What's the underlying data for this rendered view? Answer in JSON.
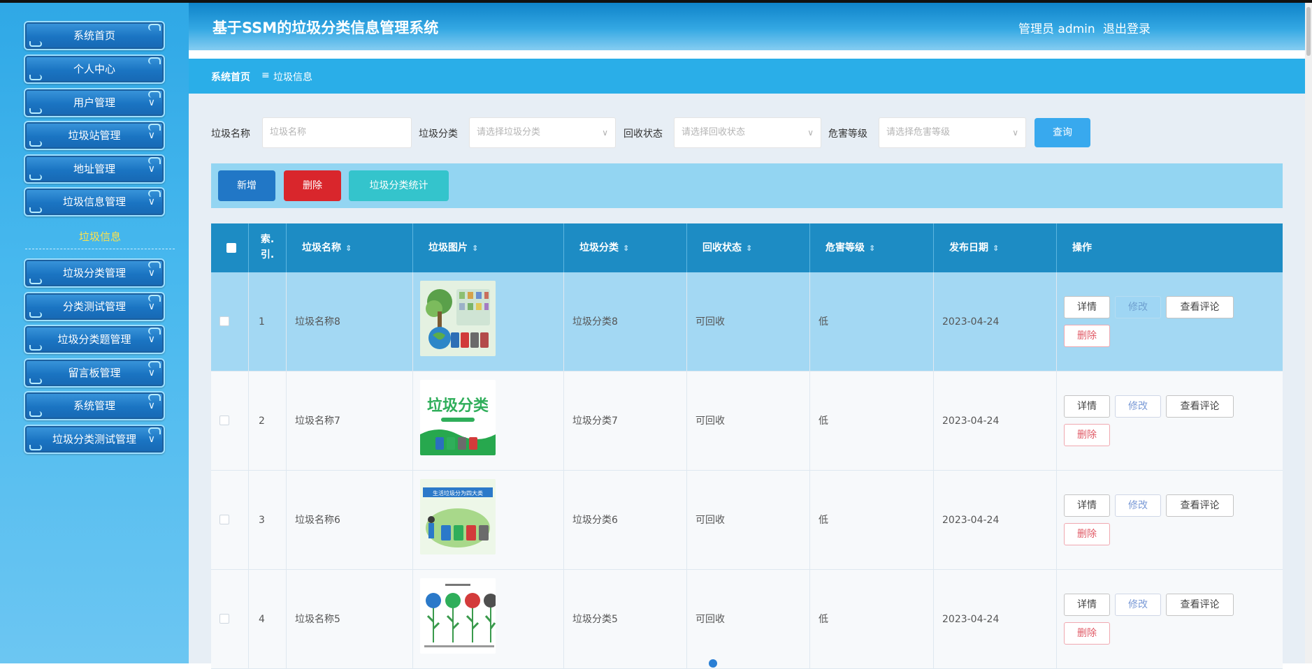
{
  "app": {
    "title": "基于SSM的垃圾分类信息管理系统",
    "user": "管理员 admin",
    "logout": "退出登录"
  },
  "sidebar": {
    "items": [
      {
        "label": "系统首页"
      },
      {
        "label": "个人中心"
      },
      {
        "label": "用户管理"
      },
      {
        "label": "垃圾站管理"
      },
      {
        "label": "地址管理"
      },
      {
        "label": "垃圾信息管理"
      },
      {
        "label": "垃圾分类管理"
      },
      {
        "label": "分类测试管理"
      },
      {
        "label": "垃圾分类题管理"
      },
      {
        "label": "留言板管理"
      },
      {
        "label": "系统管理"
      },
      {
        "label": "垃圾分类测试管理"
      }
    ],
    "active_sub": "垃圾信息"
  },
  "breadcrumb": {
    "home": "系统首页",
    "separator": "≡",
    "current": "垃圾信息"
  },
  "filters": {
    "name_label": "垃圾名称",
    "name_placeholder": "垃圾名称",
    "category_label": "垃圾分类",
    "category_placeholder": "请选择垃圾分类",
    "status_label": "回收状态",
    "status_placeholder": "请选择回收状态",
    "hazard_label": "危害等级",
    "hazard_placeholder": "请选择危害等级",
    "query_label": "查询"
  },
  "toolbar": {
    "add_label": "新增",
    "delete_label": "删除",
    "stats_label": "垃圾分类统计"
  },
  "table": {
    "headers": [
      "索引",
      "垃圾名称",
      "垃圾图片",
      "垃圾分类",
      "回收状态",
      "危害等级",
      "发布日期",
      "操作"
    ],
    "index_header_line1": "索.",
    "index_header_line2": "引.",
    "sort_icon": "⇕",
    "actions": {
      "detail": "详情",
      "edit": "修改",
      "comments": "查看评论",
      "delete": "删除"
    },
    "rows": [
      {
        "index": "1",
        "name": "垃圾名称8",
        "category": "垃圾分类8",
        "status": "可回收",
        "hazard": "低",
        "date": "2023-04-24"
      },
      {
        "index": "2",
        "name": "垃圾名称7",
        "category": "垃圾分类7",
        "status": "可回收",
        "hazard": "低",
        "date": "2023-04-24"
      },
      {
        "index": "3",
        "name": "垃圾名称6",
        "category": "垃圾分类6",
        "status": "可回收",
        "hazard": "低",
        "date": "2023-04-24"
      },
      {
        "index": "4",
        "name": "垃圾名称5",
        "category": "垃圾分类5",
        "status": "可回收",
        "hazard": "低",
        "date": "2023-04-24"
      }
    ]
  },
  "thumbnails": {
    "row2_text": "垃圾分类",
    "row3_text": "生活垃圾分为四大类"
  },
  "colors": {
    "header": "#1a8fd0",
    "breadcrumb": "#2aaee8",
    "query": "#38a9ee",
    "add": "#2177c6",
    "delete": "#d9262c",
    "stats": "#34c4cc",
    "thead": "#1d8cc4",
    "active_row": "#a3d8f3"
  }
}
